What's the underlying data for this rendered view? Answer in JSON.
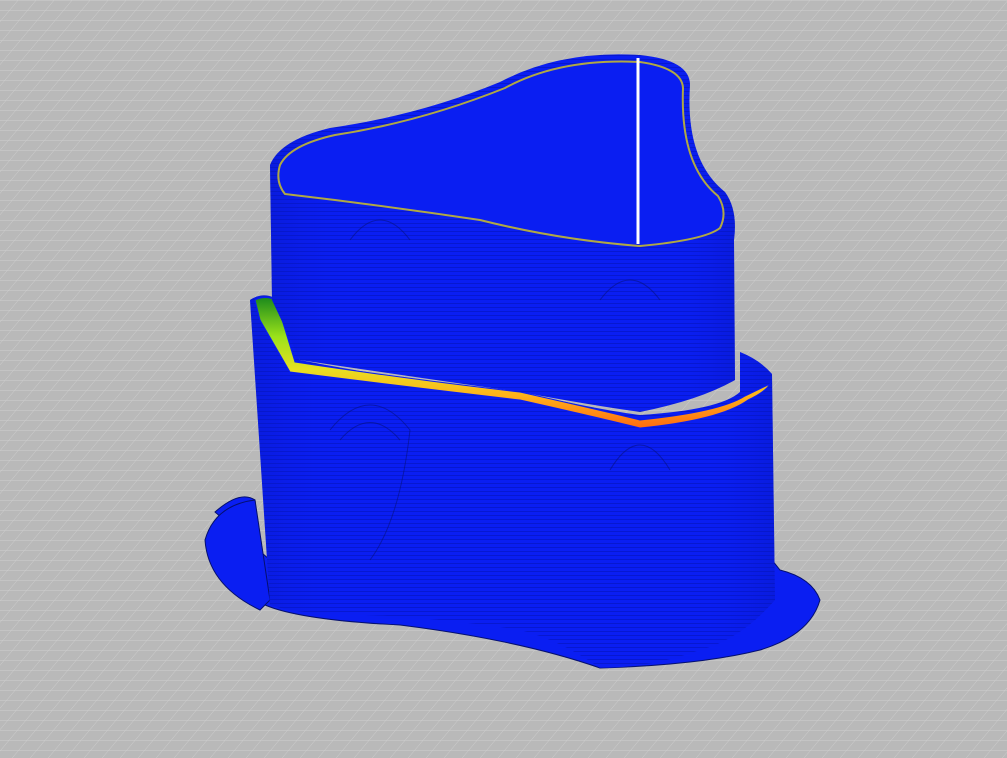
{
  "viewport": {
    "background_color": "#b9b9b9",
    "grid_line_color": "#cfcfcf"
  },
  "model": {
    "wall_color": "#0a1ef2",
    "wall_shadow_color": "#0716b8",
    "layer_line_color": "#05106e",
    "top_edge_color": "#b0a844",
    "seam_color": "#ffffff",
    "layer_gradient_colors": [
      "#1c8a1c",
      "#3fbf1f",
      "#9be21a",
      "#e8e020",
      "#ffb21a",
      "#ff6a10"
    ]
  }
}
